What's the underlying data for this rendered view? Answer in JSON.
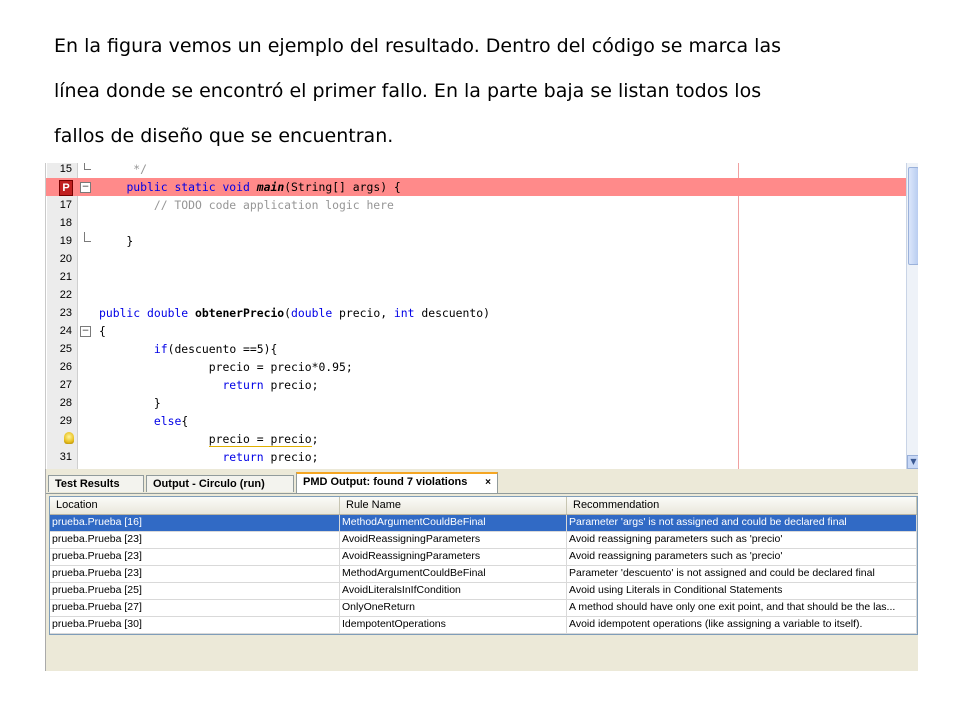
{
  "caption": {
    "line1": "En la figura vemos un ejemplo del resultado. Dentro del código se marca las",
    "line2": "línea donde se encontró el primer fallo. En la parte baja se listan todos los",
    "line3": "fallos de diseño que se encuentran."
  },
  "editor": {
    "colors": {
      "error_line": "#ff8a8a",
      "keyword": "#0000e6",
      "comment": "#969696"
    },
    "lines": [
      {
        "n": "15",
        "code": "     */"
      },
      {
        "n": "",
        "code": "    public static void main(String[] args) {",
        "marker": "P"
      },
      {
        "n": "17",
        "code": "        // TODO code application logic here"
      },
      {
        "n": "18",
        "code": ""
      },
      {
        "n": "19",
        "code": "    }"
      },
      {
        "n": "20",
        "code": ""
      },
      {
        "n": "21",
        "code": ""
      },
      {
        "n": "22",
        "code": ""
      },
      {
        "n": "23",
        "code": "public double obtenerPrecio(double precio, int descuento)"
      },
      {
        "n": "24",
        "code": "{"
      },
      {
        "n": "25",
        "code": "        if(descuento ==5){"
      },
      {
        "n": "26",
        "code": "                precio = precio*0.95;"
      },
      {
        "n": "27",
        "code": "                  return precio;"
      },
      {
        "n": "28",
        "code": "        }"
      },
      {
        "n": "29",
        "code": "        else{"
      },
      {
        "n": "",
        "code": "                precio = precio;",
        "icon": "lightbulb-icon"
      },
      {
        "n": "31",
        "code": "                  return precio;"
      }
    ]
  },
  "output": {
    "tabs": [
      {
        "label": "Test Results"
      },
      {
        "label": "Output - Circulo (run)"
      },
      {
        "label": "PMD Output: found 7 violations",
        "close": "×"
      }
    ],
    "columns": [
      "Location",
      "Rule Name",
      "Recommendation"
    ],
    "rows": [
      [
        "prueba.Prueba [16]",
        "MethodArgumentCouldBeFinal",
        "Parameter 'args' is not assigned and could be declared final"
      ],
      [
        "prueba.Prueba [23]",
        "AvoidReassigningParameters",
        "Avoid reassigning parameters such as 'precio'"
      ],
      [
        "prueba.Prueba [23]",
        "AvoidReassigningParameters",
        "Avoid reassigning parameters such as 'precio'"
      ],
      [
        "prueba.Prueba [23]",
        "MethodArgumentCouldBeFinal",
        "Parameter 'descuento' is not assigned and could be declared final"
      ],
      [
        "prueba.Prueba [25]",
        "AvoidLiteralsInIfCondition",
        "Avoid using Literals in Conditional Statements"
      ],
      [
        "prueba.Prueba [27]",
        "OnlyOneReturn",
        "A method should have only one exit point, and that should be the las..."
      ],
      [
        "prueba.Prueba [30]",
        "IdempotentOperations",
        "Avoid idempotent operations (like assigning a variable to itself)."
      ]
    ],
    "selected_row_color": "#316ac5"
  }
}
